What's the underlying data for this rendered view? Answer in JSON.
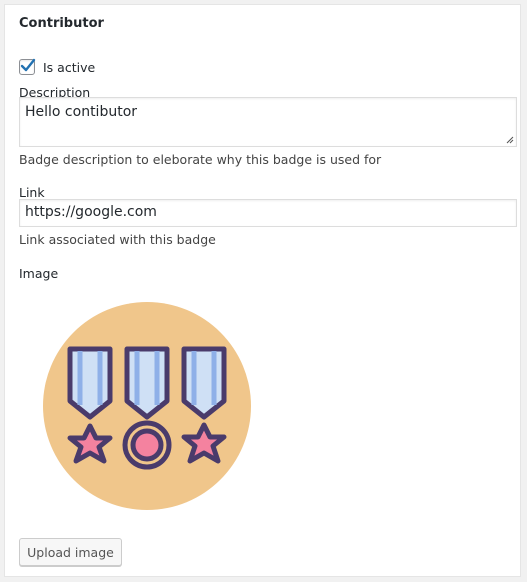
{
  "panel": {
    "title": "Contributor",
    "is_active": {
      "label": "Is active",
      "checked": true
    },
    "description": {
      "label": "Description",
      "value": "Hello contibutor",
      "help": "Badge description to eleborate why this badge is used for"
    },
    "link": {
      "label": "Link",
      "value": "https://google.com",
      "help": "Link associated with this badge"
    },
    "image": {
      "label": "Image",
      "icon": "medals-icon"
    },
    "upload_button": "Upload image"
  },
  "colors": {
    "checkmark": "#2271b1",
    "badge_circle": "#f0c68b",
    "medal_outline": "#4a3b6b",
    "ribbon_light": "#cfe0f5",
    "ribbon_mid": "#8fb0e8",
    "medal_pink": "#f4829f"
  }
}
